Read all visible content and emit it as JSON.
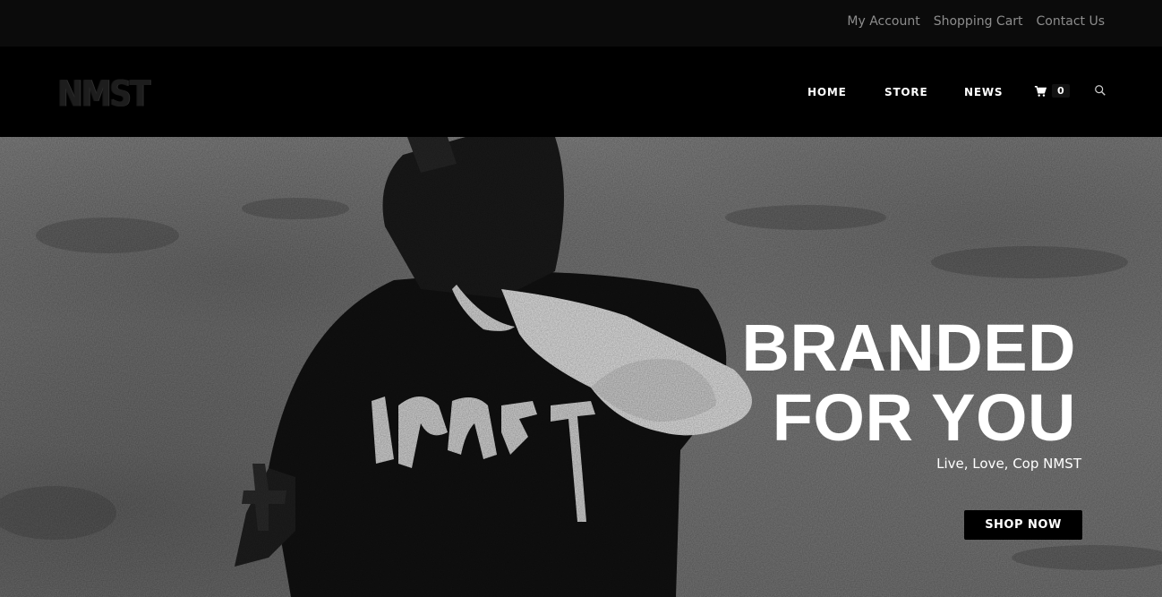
{
  "top_links": [
    "My Account",
    "Shopping Cart",
    "Contact Us"
  ],
  "logo": {
    "text": "NMST"
  },
  "nav": {
    "home": "HOME",
    "store": "STORE",
    "news": "NEWS",
    "cart_count": "0",
    "cart_icon": "cart-icon",
    "search_icon": "search-icon"
  },
  "hero": {
    "headline_line1": "BRANDED",
    "headline_line2": "FOR YOU",
    "tagline": "Live, Love, Cop NMST",
    "cta": "SHOP NOW",
    "shirt_print": "NMST"
  },
  "colors": {
    "topbar": "#0b0b0b",
    "navbar": "#000000",
    "hero_bg": "#818181",
    "button": "#000000",
    "text": "#ffffff"
  }
}
